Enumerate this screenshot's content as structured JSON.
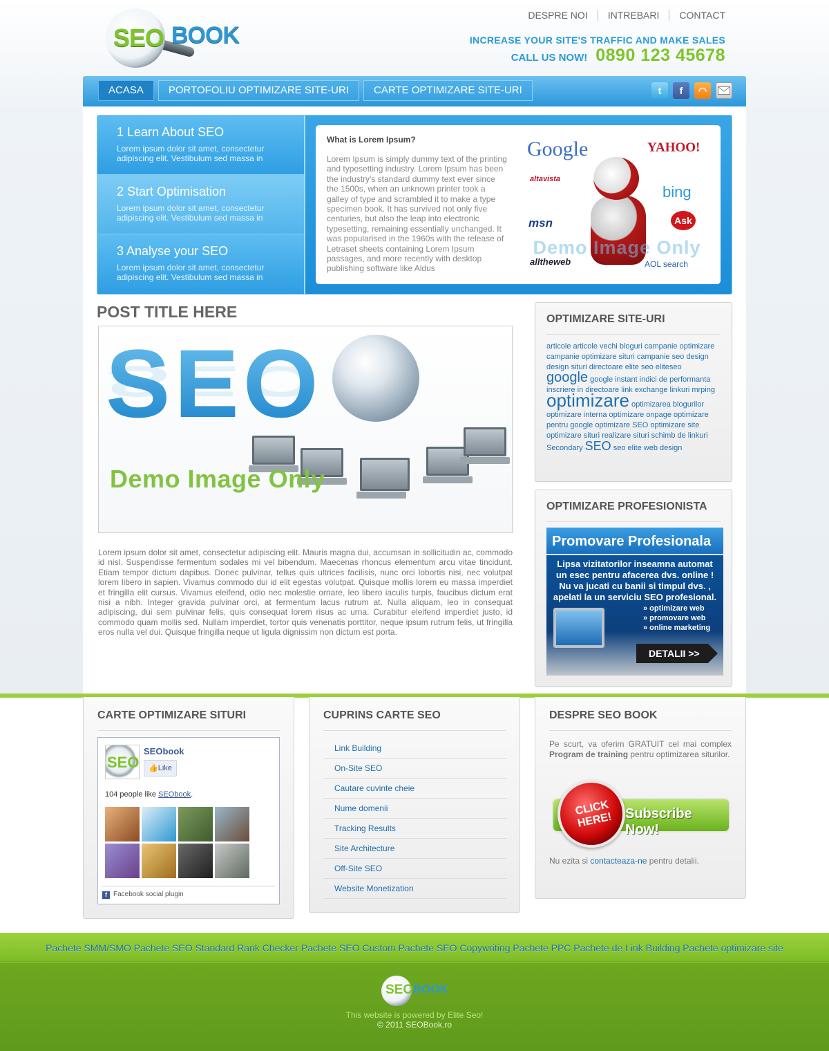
{
  "header": {
    "logo": {
      "part1": "SEO",
      "part2": "BOOK"
    },
    "top_nav": [
      "DESPRE NOI",
      "INTREBARI",
      "CONTACT"
    ],
    "tagline": "INCREASE YOUR SITE'S TRAFFIC AND MAKE SALES",
    "call_label": "CALL US NOW!",
    "phone": "0890 123 45678"
  },
  "nav": {
    "tabs": [
      "ACASA",
      "PORTOFOLIU OPTIMIZARE SITE-URI",
      "CARTE OPTIMIZARE SITE-URI"
    ],
    "active": "ACASA",
    "social_icons": [
      "twitter-icon",
      "facebook-icon",
      "rss-icon",
      "mail-icon"
    ]
  },
  "slider": {
    "steps": [
      {
        "title": "1 Learn About SEO",
        "text": "Lorem ipsum dolor sit amet, consectetur adipiscing elit. Vestibulum sed massa in"
      },
      {
        "title": "2 Start Optimisation",
        "text": "Lorem ipsum dolor sit amet, consectetur adipiscing elit. Vestibulum sed massa in"
      },
      {
        "title": "3 Analyse your SEO",
        "text": "Lorem ipsum dolor sit amet, consectetur adipiscing elit. Vestibulum sed massa in"
      }
    ],
    "slide_title": "What is Lorem Ipsum?",
    "slide_text": "Lorem Ipsum is simply dummy text of the printing and typesetting industry. Lorem Ipsum has been the industry's standard dummy text ever since the 1500s, when an unknown printer took a galley of type and scrambled it to make a type specimen book. It has survived not only five centuries, but also the leap into electronic typesetting, remaining essentially unchanged. It was popularised in the 1960s with the release of Letraset sheets containing Lorem Ipsum passages, and more recently with desktop publishing software like Aldus",
    "image_logos": [
      "Google",
      "YAHOO!",
      "altavista",
      "bing",
      "msn",
      "Ask",
      "alltheweb",
      "AOL search"
    ],
    "image_watermark": "Demo Image Only"
  },
  "post": {
    "title": "POST TITLE HERE",
    "image_big_text": "SEO",
    "image_watermark": "Demo Image Only",
    "body": "Lorem ipsum dolor sit amet, consectetur adipiscing elit. Mauris magna dui, accumsan in sollicitudin ac, commodo id nisl. Suspendisse fermentum sodales mi vel bibendum. Maecenas rhoncus elementum arcu vitae tincidunt. Etiam tempor dictum dapibus. Donec pulvinar, tellus quis ultrices facilisis, nunc orci lobortis nisi, nec volutpat lorem libero in sapien. Vivamus commodo dui id elit egestas volutpat. Quisque mollis lorem eu massa imperdiet et fringilla elit cursus. Vivamus eleifend, odio nec molestie ornare, leo libero iaculis turpis, faucibus dictum erat nisi a nibh. Integer gravida pulvinar orci, at fermentum lacus rutrum at. Nulla aliquam, leo in consequat adipiscing, dui sem pulvinar felis, quis consequat lorem risus ac urna. Curabitur eleifend imperdiet justo, id commodo quam mollis sed. Nullam imperdiet, tortor quis venenatis porttitor, neque ipsum rutrum felis, ut fringilla eros nulla vel dui. Quisque fringilla neque ut ligula dignissim non dictum est porta."
  },
  "sidebar": {
    "tags_title": "OPTIMIZARE SITE-URI",
    "tags": {
      "t1": "articole articole vechi bloguri campanie optimizare campanie optimizare situri campanie seo design design situri directoare elite seo eliteseo",
      "t2": "google",
      "t3": "google instant indici de performanta inscriere in directoare link exchange linkuri mrping",
      "t4": "optimizare",
      "t5": "optimizarea blogurilor optimizare interna optimizare onpage optimizare pentru google optimizare SEO optimizare site optimizare situri realizare situri schimb de linkuri",
      "t6": "Secondary",
      "t7": "SEO",
      "t8": "seo elite web design"
    },
    "promo_title": "OPTIMIZARE PROFESIONISTA",
    "promo": {
      "header": "Promovare Profesionala",
      "text": "Lipsa vizitatorilor inseamna automat un esec pentru afacerea dvs. online ! Nu va jucati cu banii si timpul dvs. , apelati la un serviciu SEO profesional.",
      "list": [
        "» optimizare web",
        "» promovare web",
        "» online marketing"
      ],
      "button": "DETALII >>"
    }
  },
  "footer": {
    "box1_title": "CARTE OPTIMIZARE SITURI",
    "fb": {
      "page_name": "SEObook",
      "like_label": "Like",
      "likes_prefix": "104 people like",
      "likes_link": "SEObook",
      "likes_suffix": ".",
      "plugin_label": "Facebook social plugin"
    },
    "box2_title": "CUPRINS CARTE SEO",
    "toc": [
      "Link Building",
      "On-Site SEO",
      "Cautare cuvinte cheie",
      "Nume domenii",
      "Tracking Results",
      "Site Architecture",
      "Off-Site SEO",
      "Website Monetization"
    ],
    "box3_title": "DESPRE SEO BOOK",
    "about_pre": "Pe scurt, va oferim GRATUIT cel mai complex",
    "about_bold": "Program de training",
    "about_post": "pentru optimizarea siturilor.",
    "subscribe_circle": "CLICK HERE!",
    "subscribe_text": "Subscribe Now!",
    "contact_pre": "Nu ezita si",
    "contact_link": "contacteaza-ne",
    "contact_post": "pentru detalii."
  },
  "bottom": {
    "links": "Pachete SMM/SMO Pachete SEO Standard Rank Checker Pachete SEO Custom Pachete SEO Copywriting Pachete PPC Pachete de Link Building Pachete optimizare site",
    "credit1": "This website is powered by Elite Seo!",
    "credit2": "© 2011 SEOBook.ro"
  },
  "colors": {
    "brand_blue": "#2a9ad8",
    "brand_green": "#7ec42b",
    "link_blue": "#1f6fb2",
    "footer_green": "#7fbd26"
  }
}
